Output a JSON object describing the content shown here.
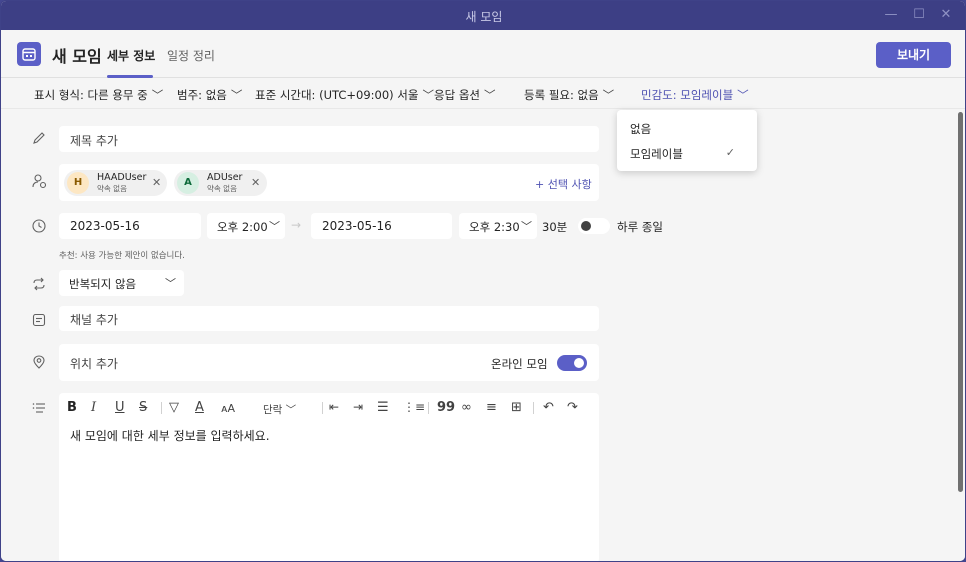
{
  "window": {
    "title": "새 모임",
    "minimize_glyph": "—",
    "maximize_glyph": "☐",
    "close_glyph": "✕"
  },
  "header": {
    "title": "새 모임",
    "tabs": [
      {
        "label": "세부 정보"
      },
      {
        "label": "일정 정리"
      }
    ],
    "send_label": "보내기"
  },
  "options": {
    "show_as": "표시 형식: 다른 용무 중",
    "category": "범주: 없음",
    "timezone": "표준 시간대: (UTC+09:00) 서울",
    "response": "응답 옵션",
    "registration": "등록 필요: 없음",
    "sensitivity": "민감도: 모임레이블"
  },
  "sensitivity_menu": {
    "items": [
      {
        "label": "없음"
      },
      {
        "label": "모임레이블"
      }
    ],
    "check": "✓"
  },
  "form": {
    "title_placeholder": "제목 추가",
    "attendees": [
      {
        "initial": "H",
        "name": "HAADUser",
        "status": "약속 없음",
        "color": "#fde7c3",
        "text_color": "#8a5a00"
      },
      {
        "initial": "A",
        "name": "ADUser",
        "status": "약속 없음",
        "color": "#d6efe2",
        "text_color": "#0e6b3b"
      }
    ],
    "optional_label": "+ 선택 사항",
    "start_date": "2023-05-16",
    "start_time": "오후 2:00",
    "end_date": "2023-05-16",
    "end_time": "오후 2:30",
    "duration": "30분",
    "all_day_label": "하루 종일",
    "suggestion": "추천: 사용 가능한 제안이 없습니다.",
    "repeat": "반복되지 않음",
    "channel_placeholder": "채널 추가",
    "location_placeholder": "위치 추가",
    "online_label": "온라인 모임",
    "paragraph_label": "단락",
    "body_placeholder": "새 모임에 대한 세부 정보를 입력하세요."
  },
  "colors": {
    "accent": "#5b5fc7",
    "titlebar": "#3d3f85"
  }
}
